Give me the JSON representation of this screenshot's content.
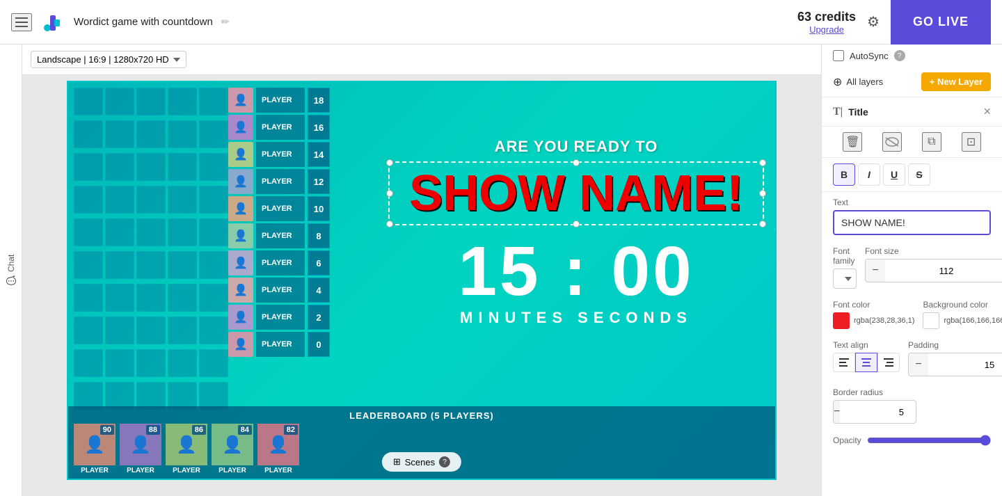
{
  "header": {
    "title": "Wordict game with countdown",
    "credits_amount": "63",
    "credits_label": "credits",
    "upgrade_label": "Upgrade",
    "go_live_label": "GO LIVE"
  },
  "toolbar": {
    "resolution_label": "Landscape | 16:9 | 1280x720 HD"
  },
  "canvas": {
    "are_you_ready": "ARE YOU READY TO",
    "show_name": "SHOW NAME!",
    "timer_minutes": "15",
    "timer_colon": ":",
    "timer_seconds": "00",
    "timer_label": "MINUTES   SECONDS",
    "leaderboard_title": "LEADERBOARD (5 players)",
    "scenes_label": "Scenes"
  },
  "players": [
    {
      "name": "PLAYER",
      "score": "18"
    },
    {
      "name": "PLAYER",
      "score": "16"
    },
    {
      "name": "PLAYER",
      "score": "14"
    },
    {
      "name": "PLAYER",
      "score": "12"
    },
    {
      "name": "PLAYER",
      "score": "10"
    },
    {
      "name": "PLAYER",
      "score": "8"
    },
    {
      "name": "PLAYER",
      "score": "6"
    },
    {
      "name": "PLAYER",
      "score": "4"
    },
    {
      "name": "PLAYER",
      "score": "2"
    },
    {
      "name": "PLAYER",
      "score": "0"
    }
  ],
  "leaderboard_players": [
    {
      "name": "PLAYER",
      "score": "90"
    },
    {
      "name": "PLAYER",
      "score": "88"
    },
    {
      "name": "PLAYER",
      "score": "86"
    },
    {
      "name": "PLAYER",
      "score": "84"
    },
    {
      "name": "PLAYER",
      "score": "82"
    }
  ],
  "right_panel": {
    "autosync_label": "AutoSync",
    "all_layers_label": "All layers",
    "new_layer_label": "+ New Layer",
    "layer_title": "Title",
    "text_label": "Text",
    "text_value": "SHOW NAME!",
    "font_family_label": "Font family",
    "font_size_label": "Font size",
    "font_family_value": "Anton",
    "font_size_value": "112",
    "font_color_label": "Font color",
    "font_color_value": "rgba(238,28,36,1)",
    "bg_color_label": "Background color",
    "bg_color_value": "rgba(166,166,166,0)",
    "text_align_label": "Text align",
    "padding_label": "Padding",
    "padding_value": "15",
    "border_radius_label": "Border radius",
    "border_radius_value": "5",
    "opacity_label": "Opacity",
    "opacity_value": "100"
  },
  "icons": {
    "hamburger": "☰",
    "edit": "✏",
    "settings": "⚙",
    "delete": "🗑",
    "hide": "◌",
    "copy": "⧉",
    "crop": "⊡",
    "bold": "B",
    "italic": "I",
    "underline": "U",
    "strikethrough": "S",
    "align_left": "≡",
    "align_center": "≡",
    "align_right": "≡",
    "layers": "⊕",
    "plus": "+",
    "minus": "−",
    "close": "×",
    "text_icon": "T",
    "chat_icon": "💬"
  }
}
